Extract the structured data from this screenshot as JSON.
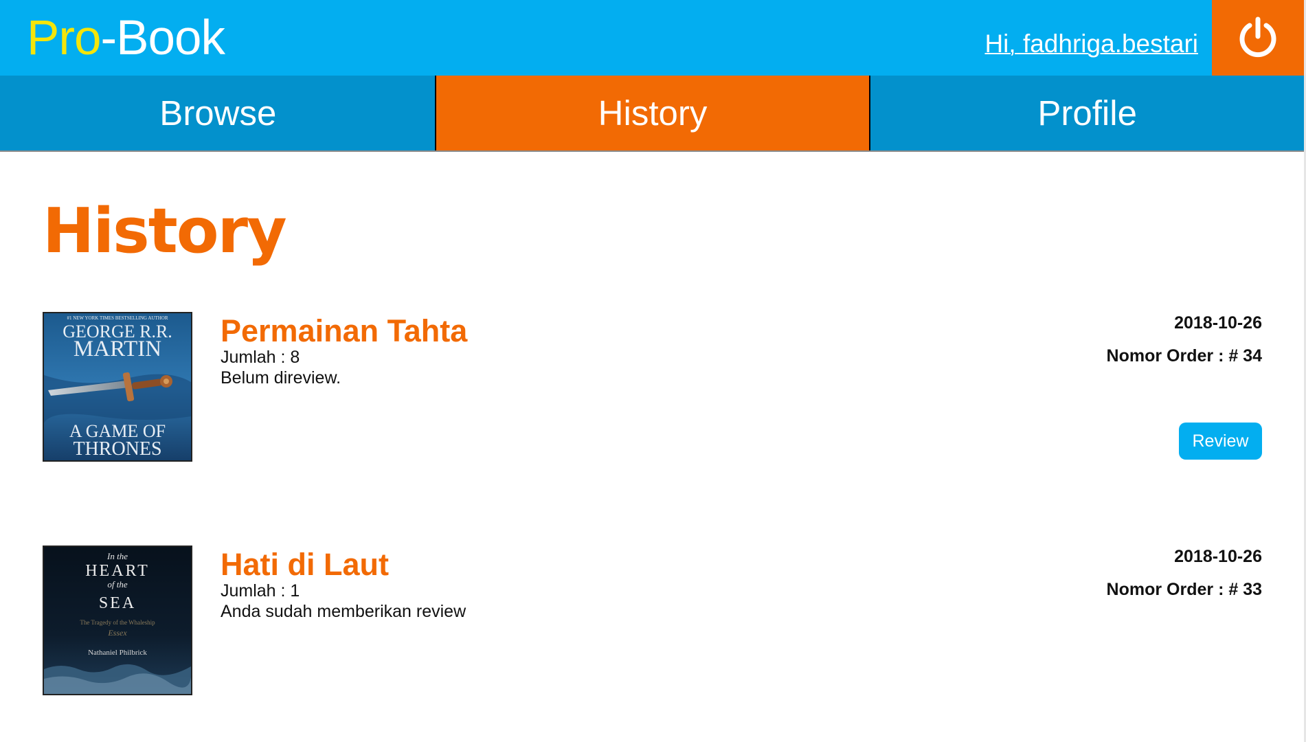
{
  "header": {
    "logo_pro": "Pro",
    "logo_rest": "-Book",
    "greeting": "Hi, fadhriga.bestari",
    "logout_icon": "power-icon"
  },
  "nav": {
    "tabs": [
      {
        "label": "Browse",
        "active": false
      },
      {
        "label": "History",
        "active": true
      },
      {
        "label": "Profile",
        "active": false
      }
    ]
  },
  "main": {
    "title": "History",
    "orders": [
      {
        "book_title": "Permainan Tahta",
        "quantity_text": "Jumlah : 8",
        "review_status": "Belum direview.",
        "date": "2018-10-26",
        "order_number": "Nomor Order : # 34",
        "review_button": "Review",
        "cover": {
          "top_line": "#1 NEW YORK TIMES BESTSELLING AUTHOR",
          "author_line1": "GEORGE R.R.",
          "author_line2": "MARTIN",
          "title_line1": "A GAME OF",
          "title_line2": "THRONES"
        }
      },
      {
        "book_title": "Hati di Laut",
        "quantity_text": "Jumlah : 1",
        "review_status": "Anda sudah memberikan review",
        "date": "2018-10-26",
        "order_number": "Nomor Order : # 33",
        "cover": {
          "line1": "In the",
          "line2": "HEART",
          "line3": "of the",
          "line4": "SEA",
          "subtitle1": "The Tragedy of the Whaleship",
          "subtitle2": "Essex",
          "author": "Nathaniel Philbrick"
        }
      }
    ]
  },
  "colors": {
    "header_blue": "#03aef0",
    "nav_blue": "#0391cc",
    "accent_orange": "#f26a04",
    "logo_yellow": "#f5e50a"
  }
}
